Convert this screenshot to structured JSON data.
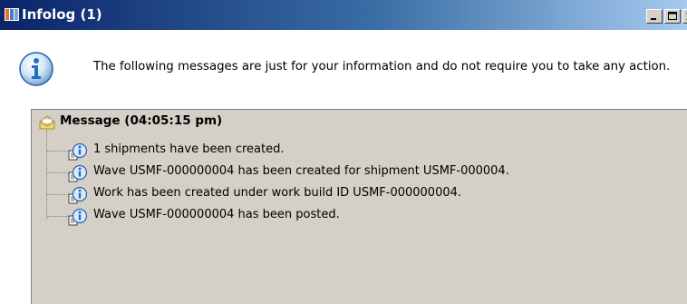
{
  "window": {
    "title": "Infolog (1)",
    "controls": [
      "minimize-icon",
      "maximize-icon",
      "close-icon"
    ]
  },
  "header": {
    "icon": "information-icon",
    "text": "The following messages are just for your information and do not require you to take any action."
  },
  "tree": {
    "root": {
      "icon": "envelope-icon",
      "label": "Message (04:05:15 pm)"
    },
    "items": [
      {
        "icon": "info-message-icon",
        "text": "1 shipments have been created."
      },
      {
        "icon": "info-message-icon",
        "text": "Wave USMF-000000004 has been created for shipment USMF-000004."
      },
      {
        "icon": "info-message-icon",
        "text": "Work has been created under work build ID USMF-000000004."
      },
      {
        "icon": "info-message-icon",
        "text": "Wave USMF-000000004 has been posted."
      }
    ]
  },
  "colors": {
    "titlebar_start": "#0a246a",
    "titlebar_end": "#a6caf0",
    "panel_background": "#d4d0c8",
    "info_blue": "#1f6fc4"
  }
}
